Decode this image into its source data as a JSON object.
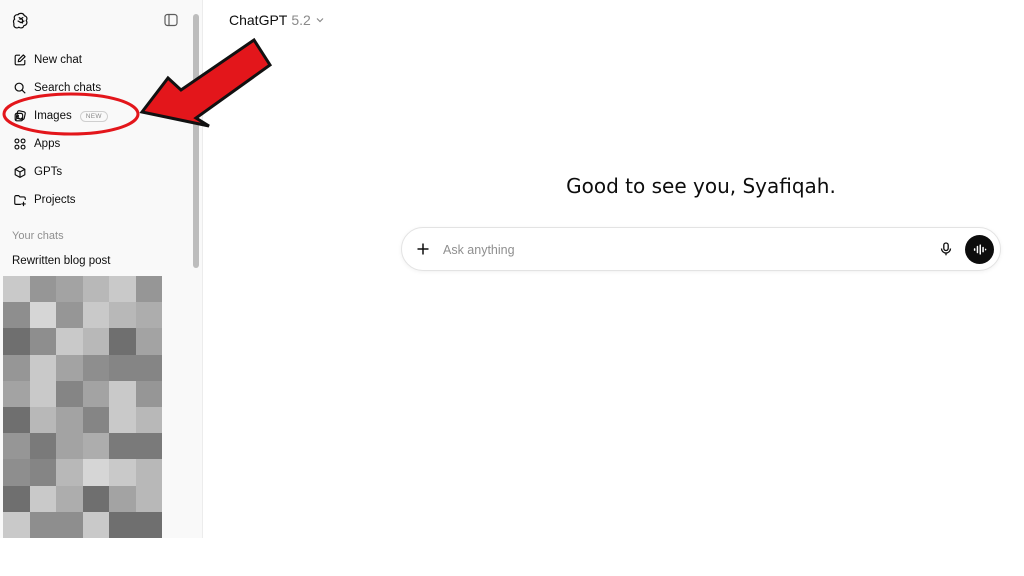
{
  "header": {
    "model_name": "ChatGPT",
    "model_version": "5.2"
  },
  "sidebar": {
    "items": [
      {
        "label": "New chat",
        "icon": "edit-icon"
      },
      {
        "label": "Search chats",
        "icon": "search-icon"
      },
      {
        "label": "Images",
        "icon": "images-icon",
        "badge": "NEW"
      },
      {
        "label": "Apps",
        "icon": "apps-grid-icon"
      },
      {
        "label": "GPTs",
        "icon": "cube-icon"
      },
      {
        "label": "Projects",
        "icon": "folder-plus-icon"
      }
    ],
    "section_title": "Your chats",
    "chats": [
      {
        "label": "Rewritten blog post"
      }
    ]
  },
  "main": {
    "greeting": "Good to see you, Syafiqah.",
    "composer": {
      "placeholder": "Ask anything"
    }
  },
  "colors": {
    "annotation_red": "#e3161b",
    "sidebar_bg": "#f9f9f9",
    "voice_button": "#0d0d0d"
  }
}
